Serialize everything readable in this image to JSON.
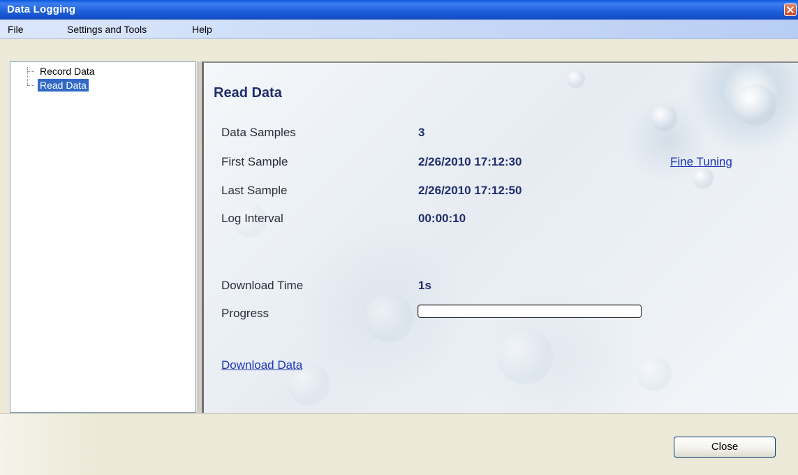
{
  "window": {
    "title": "Data Logging"
  },
  "menu": {
    "items": [
      "File",
      "Settings and Tools",
      "Help"
    ]
  },
  "tree": {
    "items": [
      {
        "label": "Record Data",
        "selected": false
      },
      {
        "label": "Read Data",
        "selected": true
      }
    ]
  },
  "panel": {
    "heading": "Read Data",
    "fields": [
      {
        "label": "Data Samples",
        "value": "3"
      },
      {
        "label": "First Sample",
        "value": "2/26/2010 17:12:30"
      },
      {
        "label": "Last Sample",
        "value": "2/26/2010 17:12:50"
      },
      {
        "label": "Log Interval",
        "value": "00:00:10"
      }
    ],
    "download_time_label": "Download Time",
    "download_time_value": "1s",
    "progress_label": "Progress",
    "progress_fraction": 0,
    "fine_tuning_link": "Fine Tuning",
    "download_link": "Download Data"
  },
  "footer": {
    "close_label": "Close"
  },
  "colors": {
    "title_bar": "#1d5fd8",
    "selection": "#316ac5",
    "heading_text": "#1f2d6b",
    "link": "#1f35b7"
  }
}
